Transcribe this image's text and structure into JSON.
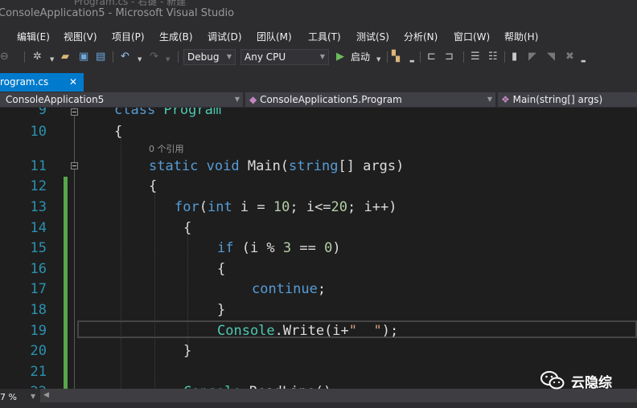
{
  "window": {
    "title": "ConsoleApplication5 - Microsoft Visual Studio",
    "clipped_top_text": "Program.cs - 右键 - 新建"
  },
  "menu": [
    "编辑(E)",
    "视图(V)",
    "项目(P)",
    "生成(B)",
    "调试(D)",
    "团队(M)",
    "工具(T)",
    "测试(S)",
    "分析(N)",
    "窗口(W)",
    "帮助(H)"
  ],
  "toolbar": {
    "config": "Debug",
    "platform": "Any CPU",
    "start_label": "启动",
    "icons": [
      "back-icon",
      "new-project-icon",
      "open-icon",
      "save-icon",
      "save-all-icon",
      "undo-icon",
      "redo-icon",
      "play-icon",
      "find-icon",
      "format-icon",
      "bookmark-icon"
    ]
  },
  "tabs": [
    {
      "label": "rogram.cs",
      "close": "✕",
      "active": true
    }
  ],
  "navbar": {
    "project": "ConsoleApplication5",
    "class": "ConsoleApplication5.Program",
    "member": "Main(string[] args)"
  },
  "editor": {
    "codelens": "0 个引用",
    "current_line": 19,
    "lines": [
      {
        "n": "9",
        "text": "class Program"
      },
      {
        "n": "10",
        "text": "{"
      },
      {
        "n": "11",
        "text": "static void Main(string[] args)"
      },
      {
        "n": "12",
        "text": "{"
      },
      {
        "n": "13",
        "text": "for(int i = 10; i<=20; i++)"
      },
      {
        "n": "14",
        "text": "{"
      },
      {
        "n": "15",
        "text": "if (i % 3 == 0)"
      },
      {
        "n": "16",
        "text": "{"
      },
      {
        "n": "17",
        "text": "continue;"
      },
      {
        "n": "18",
        "text": "}"
      },
      {
        "n": "19",
        "text": "Console.Write(i+\"  \");"
      },
      {
        "n": "20",
        "text": "}"
      },
      {
        "n": "21",
        "text": ""
      },
      {
        "n": "22",
        "text": "Console.ReadLine();"
      }
    ]
  },
  "status": {
    "zoom": "7 %"
  },
  "watermark": {
    "text": "云隐综"
  },
  "colors": {
    "accent": "#007acc",
    "keyword": "#569cd6",
    "type": "#4ec9b0",
    "number": "#b5cea8",
    "line_number": "#2b91af",
    "change_bar": "#57a64a"
  }
}
